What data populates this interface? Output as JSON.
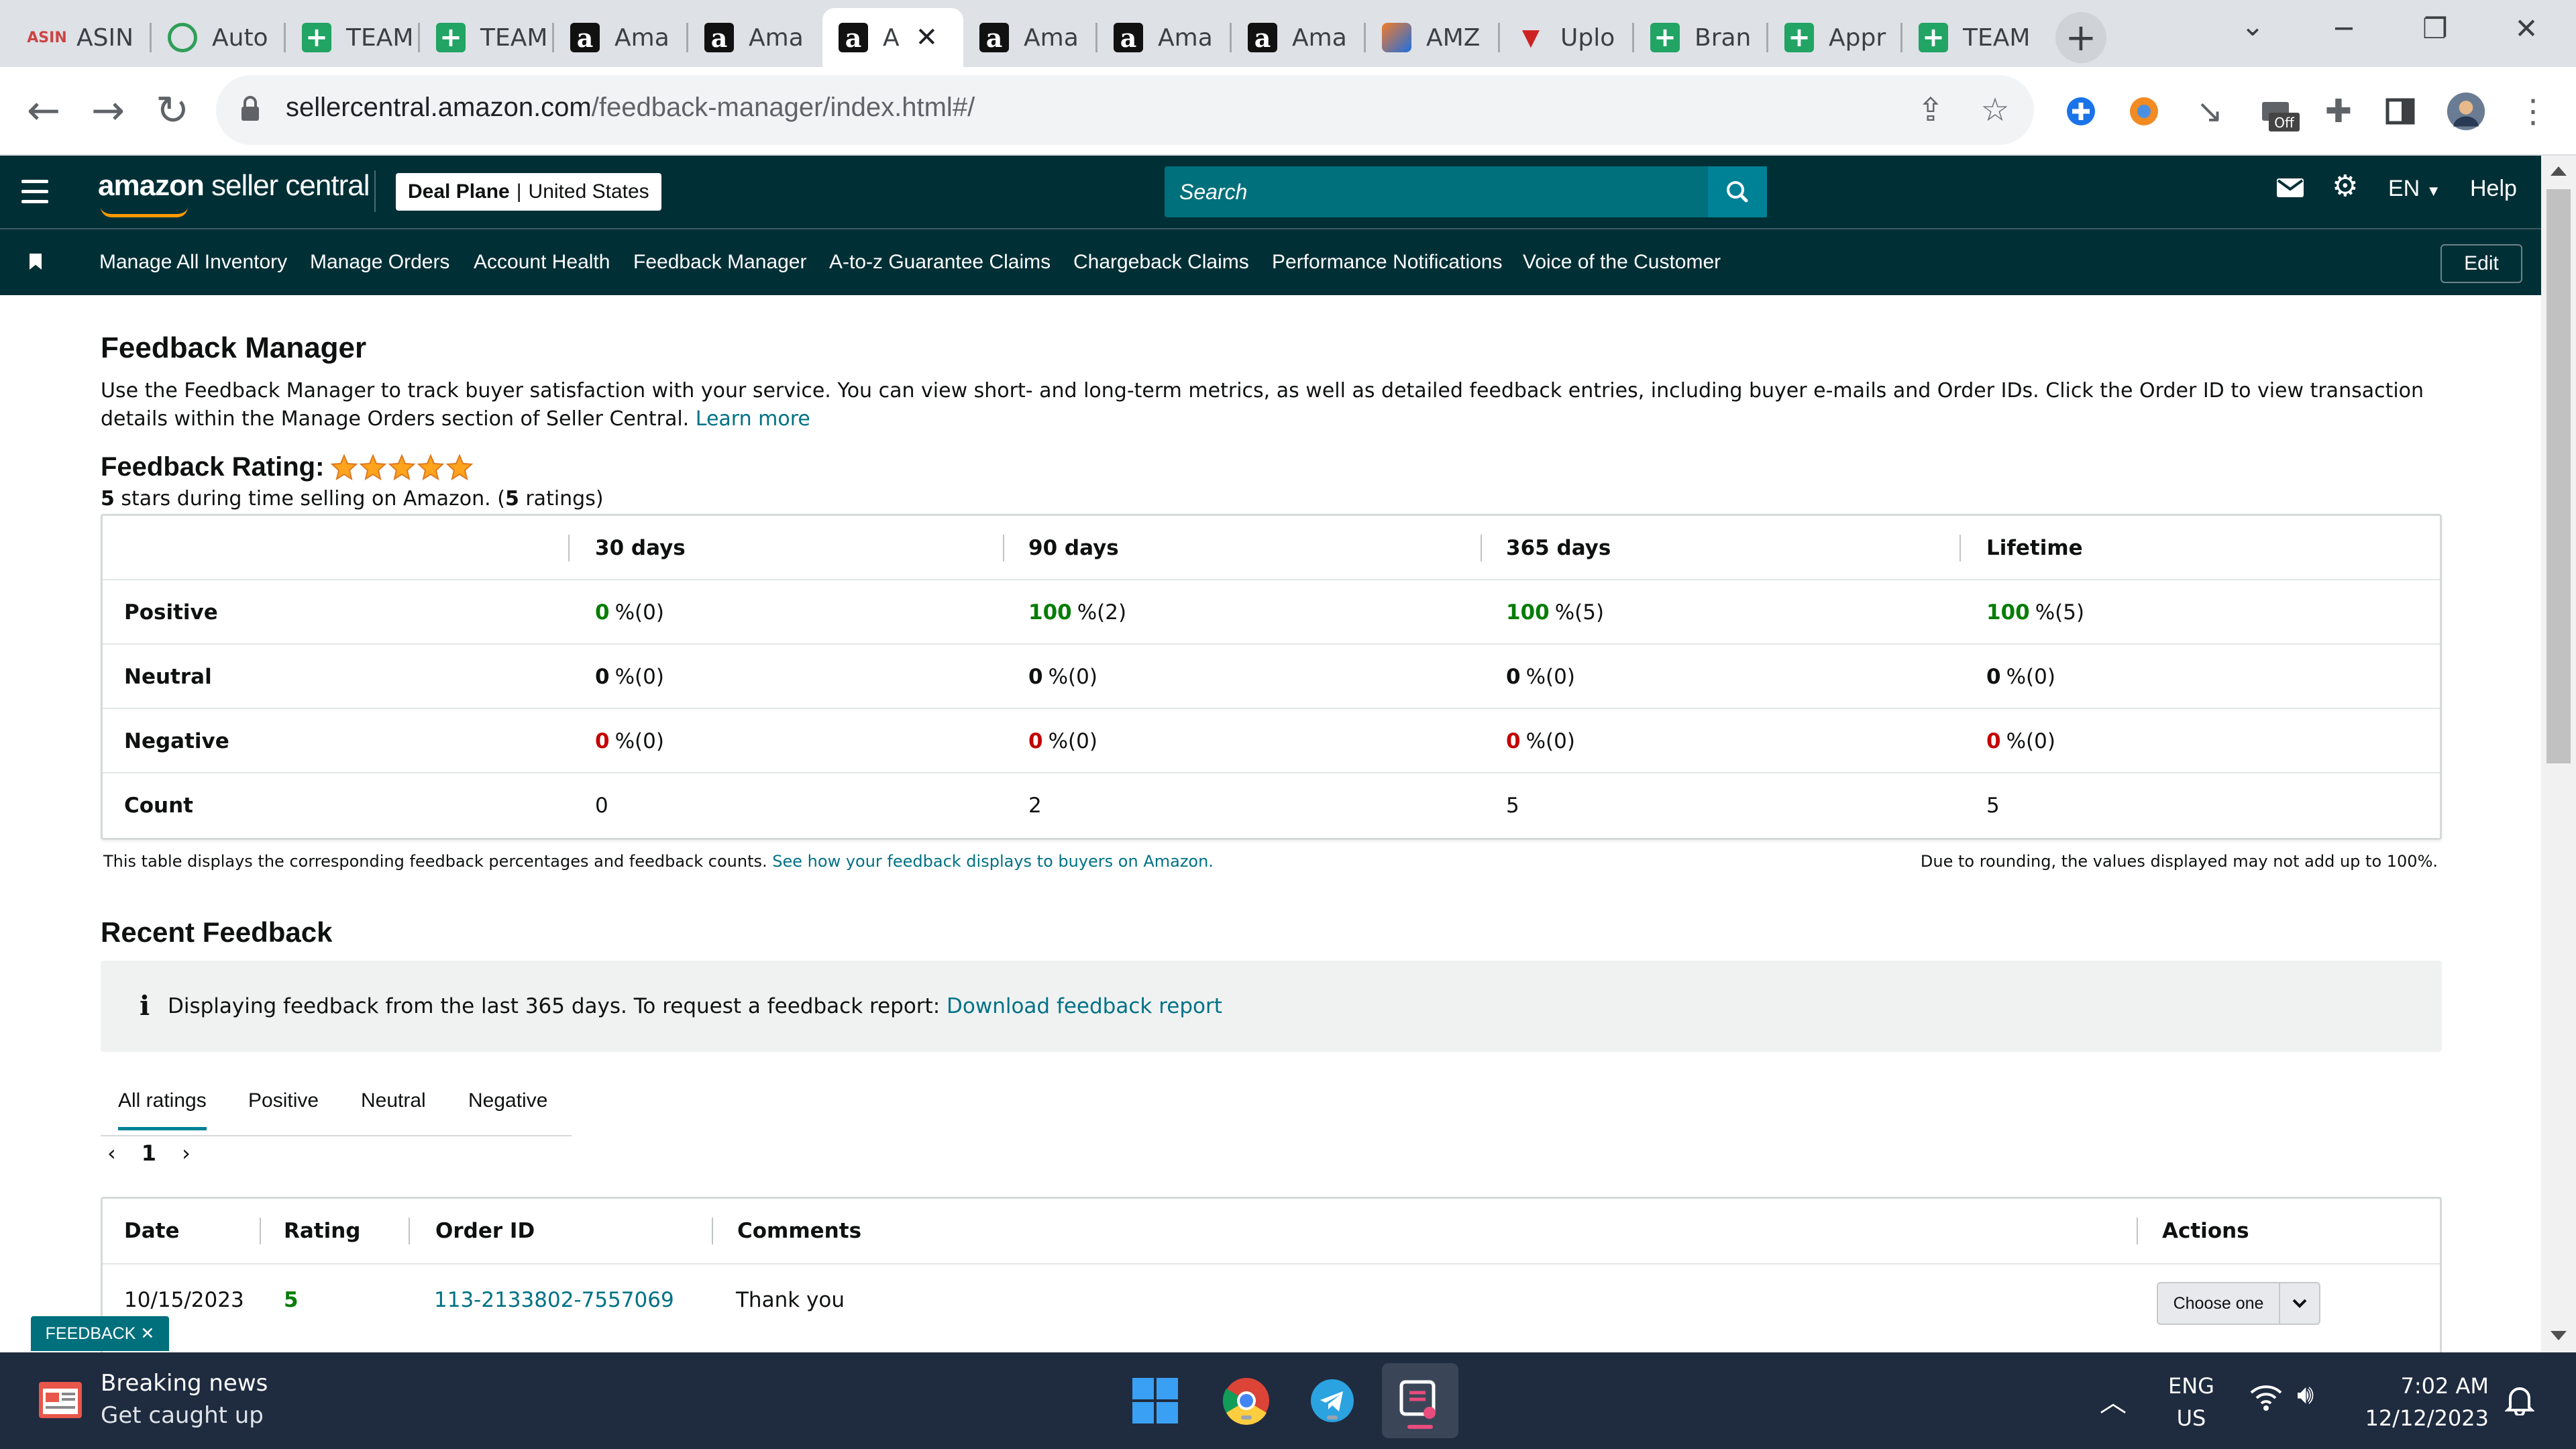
{
  "browser": {
    "tabs": [
      {
        "label": "ASIN",
        "icon": "asin-favicon"
      },
      {
        "label": "Auto",
        "icon": "auto-favicon"
      },
      {
        "label": "TEAM",
        "icon": "sheets-favicon"
      },
      {
        "label": "TEAM",
        "icon": "sheets-favicon"
      },
      {
        "label": "Ama",
        "icon": "amazon-favicon"
      },
      {
        "label": "Ama",
        "icon": "amazon-favicon"
      },
      {
        "label": "A",
        "icon": "amazon-favicon",
        "active": true
      },
      {
        "label": "Ama",
        "icon": "amazon-favicon"
      },
      {
        "label": "Ama",
        "icon": "amazon-favicon"
      },
      {
        "label": "Ama",
        "icon": "amazon-favicon"
      },
      {
        "label": "AMZ",
        "icon": "amz-favicon"
      },
      {
        "label": "Uplo",
        "icon": "upload-favicon"
      },
      {
        "label": "Bran",
        "icon": "sheets-favicon"
      },
      {
        "label": "Appr",
        "icon": "sheets-favicon"
      },
      {
        "label": "TEAM",
        "icon": "sheets-favicon"
      }
    ],
    "url_host": "sellercentral.amazon.com",
    "url_path": "/feedback-manager/index.html#/",
    "extension_badge": "Off"
  },
  "header": {
    "logo_bold": "amazon",
    "logo_rest": " seller central",
    "store_name": "Deal Plane",
    "marketplace": "United States",
    "search_placeholder": "Search",
    "language": "EN",
    "help": "Help"
  },
  "nav": {
    "links": [
      "Manage All Inventory",
      "Manage Orders",
      "Account Health",
      "Feedback Manager",
      "A-to-z Guarantee Claims",
      "Chargeback Claims",
      "Performance Notifications",
      "Voice of the Customer"
    ],
    "edit": "Edit"
  },
  "page": {
    "title": "Feedback Manager",
    "description": "Use the Feedback Manager to track buyer satisfaction with your service. You can view short- and long-term metrics, as well as detailed feedback entries, including buyer e-mails and Order IDs. Click the Order ID to view transaction details within the Manage Orders section of Seller Central.",
    "learn_more": "Learn more",
    "rating_label": "Feedback Rating:",
    "rating_stars": 5,
    "rating_summary_prefix": "5",
    "rating_summary_mid": " stars during time selling on Amazon. (",
    "rating_summary_count": "5",
    "rating_summary_suffix": " ratings)"
  },
  "metrics": {
    "columns": [
      "30 days",
      "90 days",
      "365 days",
      "Lifetime"
    ],
    "rows": [
      {
        "label": "Positive",
        "cells": [
          [
            "0",
            "%(0)"
          ],
          [
            "100",
            "%(2)"
          ],
          [
            "100",
            "%(5)"
          ],
          [
            "100",
            "%(5)"
          ]
        ]
      },
      {
        "label": "Neutral",
        "cells": [
          [
            "0",
            "%(0)"
          ],
          [
            "0",
            "%(0)"
          ],
          [
            "0",
            "%(0)"
          ],
          [
            "0",
            "%(0)"
          ]
        ]
      },
      {
        "label": "Negative",
        "cells": [
          [
            "0",
            "%(0)"
          ],
          [
            "0",
            "%(0)"
          ],
          [
            "0",
            "%(0)"
          ],
          [
            "0",
            "%(0)"
          ]
        ]
      },
      {
        "label": "Count",
        "cells": [
          [
            "0",
            ""
          ],
          [
            "2",
            ""
          ],
          [
            "5",
            ""
          ],
          [
            "5",
            ""
          ]
        ]
      }
    ],
    "note_left": "This table displays the corresponding feedback percentages and feedback counts.",
    "note_link": "See how your feedback displays to buyers on Amazon.",
    "note_right": "Due to rounding, the values displayed may not add up to 100%."
  },
  "recent": {
    "title": "Recent Feedback",
    "info": "Displaying feedback from the last 365 days. To request a feedback report:",
    "info_link": "Download feedback report",
    "tabs": [
      "All ratings",
      "Positive",
      "Neutral",
      "Negative"
    ],
    "page": "1",
    "columns": [
      "Date",
      "Rating",
      "Order ID",
      "Comments",
      "Actions"
    ],
    "rows": [
      {
        "date": "10/15/2023",
        "rating": "5",
        "order_id": "113-2133802-7557069",
        "comment": "Thank you",
        "action": "Choose one"
      }
    ],
    "feedback_tag": "FEEDBACK"
  },
  "taskbar": {
    "news_title": "Breaking news",
    "news_sub": "Get caught up",
    "lang_top": "ENG",
    "lang_bottom": "US",
    "time": "7:02 AM",
    "date": "12/12/2023"
  },
  "colors": {
    "amazon_header": "#002f36",
    "positive": "#067d06",
    "negative": "#c40000",
    "link": "#007185",
    "star": "#ffa41c"
  }
}
